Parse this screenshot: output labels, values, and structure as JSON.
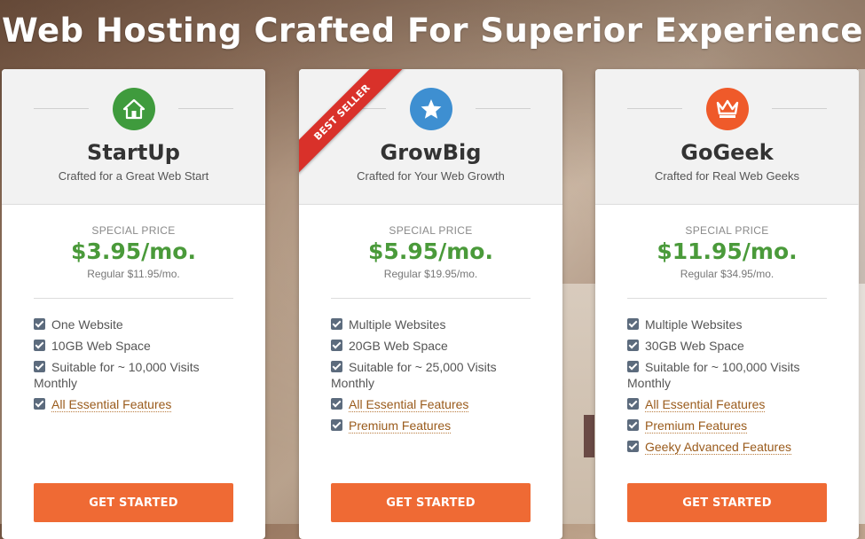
{
  "headline": "Web Hosting Crafted For Superior Experience",
  "colors": {
    "accent_green": "#4a9a3a",
    "cta_orange": "#ef6a34",
    "ribbon_red": "#d9312a",
    "startup_icon": "#3f9b3d",
    "growbig_icon": "#3e8fd1",
    "gogeek_icon": "#ef5a2a"
  },
  "plans": [
    {
      "icon": "house-icon",
      "name": "StartUp",
      "tagline": "Crafted for a Great Web Start",
      "special_label": "SPECIAL PRICE",
      "price": "$3.95/mo.",
      "regular": "Regular $11.95/mo.",
      "features": [
        {
          "text": "One Website"
        },
        {
          "text": "10GB Web Space"
        },
        {
          "text": "Suitable for ~ 10,000 Visits Monthly"
        },
        {
          "text": "All Essential Features",
          "link": true
        }
      ],
      "cta": "GET STARTED"
    },
    {
      "icon": "star-icon",
      "name": "GrowBig",
      "tagline": "Crafted for Your Web Growth",
      "ribbon": "BEST SELLER",
      "special_label": "SPECIAL PRICE",
      "price": "$5.95/mo.",
      "regular": "Regular $19.95/mo.",
      "features": [
        {
          "text": "Multiple Websites"
        },
        {
          "text": "20GB Web Space"
        },
        {
          "text": "Suitable for ~ 25,000 Visits Monthly"
        },
        {
          "text": "All Essential Features",
          "link": true
        },
        {
          "text": "Premium Features",
          "link": true
        }
      ],
      "cta": "GET STARTED"
    },
    {
      "icon": "crown-icon",
      "name": "GoGeek",
      "tagline": "Crafted for Real Web Geeks",
      "special_label": "SPECIAL PRICE",
      "price": "$11.95/mo.",
      "regular": "Regular $34.95/mo.",
      "features": [
        {
          "text": "Multiple Websites"
        },
        {
          "text": "30GB Web Space"
        },
        {
          "text": "Suitable for ~ 100,000 Visits Monthly"
        },
        {
          "text": "All Essential Features",
          "link": true
        },
        {
          "text": "Premium Features",
          "link": true
        },
        {
          "text": "Geeky Advanced Features",
          "link": true
        }
      ],
      "cta": "GET STARTED"
    }
  ]
}
